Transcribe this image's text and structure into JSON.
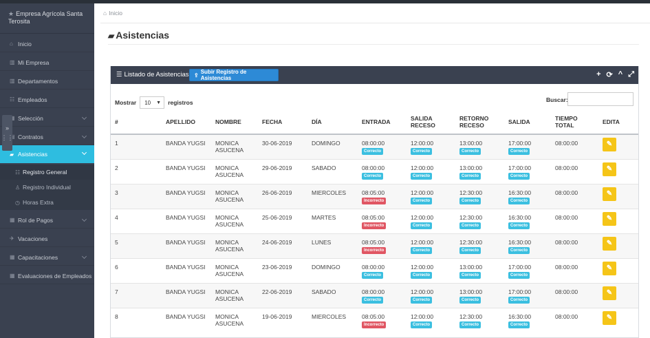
{
  "app": {
    "brand": "Empresa Agrícola Santa Terosita"
  },
  "sidebar": {
    "items": [
      {
        "label": "Inicio",
        "icon": "home-icon"
      },
      {
        "label": "Mi Empresa",
        "icon": "building-icon"
      },
      {
        "label": "Departamentos",
        "icon": "building-icon"
      },
      {
        "label": "Empleados",
        "icon": "users-icon"
      },
      {
        "label": "Selección",
        "icon": "grid-icon"
      },
      {
        "label": "Contratos",
        "icon": "file-icon"
      },
      {
        "label": "Asistencias",
        "icon": "book-icon"
      },
      {
        "label": "Rol de Pagos",
        "icon": "grid-icon"
      },
      {
        "label": "Vacaciones",
        "icon": "plane-icon"
      },
      {
        "label": "Capacitaciones",
        "icon": "grid-icon"
      },
      {
        "label": "Evaluaciones de Empleados",
        "icon": "grid-icon"
      }
    ],
    "subitems": [
      {
        "label": "Registro General",
        "icon": "users-icon"
      },
      {
        "label": "Registro Individual",
        "icon": "user-icon"
      },
      {
        "label": "Horas Extra",
        "icon": "clock-icon"
      }
    ]
  },
  "breadcrumb": {
    "home": "Inicio"
  },
  "page": {
    "title": "Asistencias"
  },
  "panel": {
    "title": "Listado de Asistencias",
    "upload_label": "Subir Registro de Asistencias",
    "tools": [
      "+",
      "⟳",
      "^",
      "⤢"
    ]
  },
  "controls": {
    "show_label": "Mostrar",
    "page_size": "10",
    "records_label": "registros",
    "search_label": "Buscar:",
    "search_value": ""
  },
  "table": {
    "headers": [
      "#",
      "APELLIDO",
      "NOMBRE",
      "FECHA",
      "DÍA",
      "ENTRADA",
      "SALIDA RECESO",
      "RETORNO RECESO",
      "SALIDA",
      "TIEMPO TOTAL",
      "EDITA"
    ],
    "rows": [
      {
        "n": "1",
        "apellido": "BANDA YUGSI",
        "nombre": "MONICA ASUCENA",
        "fecha": "30-06-2019",
        "dia": "DOMINGO",
        "entrada": "08:00:00",
        "entrada_s": "Correcto",
        "sal_rec": "12:00:00",
        "sal_rec_s": "Correcto",
        "ret_rec": "13:00:00",
        "ret_rec_s": "Correcto",
        "salida": "17:00:00",
        "salida_s": "Correcto",
        "total": "08:00:00"
      },
      {
        "n": "2",
        "apellido": "BANDA YUGSI",
        "nombre": "MONICA ASUCENA",
        "fecha": "29-06-2019",
        "dia": "SABADO",
        "entrada": "08:00:00",
        "entrada_s": "Correcto",
        "sal_rec": "12:00:00",
        "sal_rec_s": "Correcto",
        "ret_rec": "13:00:00",
        "ret_rec_s": "Correcto",
        "salida": "17:00:00",
        "salida_s": "Correcto",
        "total": "08:00:00"
      },
      {
        "n": "3",
        "apellido": "BANDA YUGSI",
        "nombre": "MONICA ASUCENA",
        "fecha": "26-06-2019",
        "dia": "MIERCOLES",
        "entrada": "08:05:00",
        "entrada_s": "Incorrecto",
        "sal_rec": "12:00:00",
        "sal_rec_s": "Correcto",
        "ret_rec": "12:30:00",
        "ret_rec_s": "Correcto",
        "salida": "16:30:00",
        "salida_s": "Correcto",
        "total": "08:00:00"
      },
      {
        "n": "4",
        "apellido": "BANDA YUGSI",
        "nombre": "MONICA ASUCENA",
        "fecha": "25-06-2019",
        "dia": "MARTES",
        "entrada": "08:05:00",
        "entrada_s": "Incorrecto",
        "sal_rec": "12:00:00",
        "sal_rec_s": "Correcto",
        "ret_rec": "12:30:00",
        "ret_rec_s": "Correcto",
        "salida": "16:30:00",
        "salida_s": "Correcto",
        "total": "08:00:00"
      },
      {
        "n": "5",
        "apellido": "BANDA YUGSI",
        "nombre": "MONICA ASUCENA",
        "fecha": "24-06-2019",
        "dia": "LUNES",
        "entrada": "08:05:00",
        "entrada_s": "Incorrecto",
        "sal_rec": "12:00:00",
        "sal_rec_s": "Correcto",
        "ret_rec": "12:30:00",
        "ret_rec_s": "Correcto",
        "salida": "16:30:00",
        "salida_s": "Correcto",
        "total": "08:00:00"
      },
      {
        "n": "6",
        "apellido": "BANDA YUGSI",
        "nombre": "MONICA ASUCENA",
        "fecha": "23-06-2019",
        "dia": "DOMINGO",
        "entrada": "08:00:00",
        "entrada_s": "Correcto",
        "sal_rec": "12:00:00",
        "sal_rec_s": "Correcto",
        "ret_rec": "13:00:00",
        "ret_rec_s": "Correcto",
        "salida": "17:00:00",
        "salida_s": "Correcto",
        "total": "08:00:00"
      },
      {
        "n": "7",
        "apellido": "BANDA YUGSI",
        "nombre": "MONICA ASUCENA",
        "fecha": "22-06-2019",
        "dia": "SABADO",
        "entrada": "08:00:00",
        "entrada_s": "Correcto",
        "sal_rec": "12:00:00",
        "sal_rec_s": "Correcto",
        "ret_rec": "13:00:00",
        "ret_rec_s": "Correcto",
        "salida": "17:00:00",
        "salida_s": "Correcto",
        "total": "08:00:00"
      },
      {
        "n": "8",
        "apellido": "BANDA YUGSI",
        "nombre": "MONICA ASUCENA",
        "fecha": "19-06-2019",
        "dia": "MIERCOLES",
        "entrada": "08:05:00",
        "entrada_s": "Incorrecto",
        "sal_rec": "12:00:00",
        "sal_rec_s": "Correcto",
        "ret_rec": "12:30:00",
        "ret_rec_s": "Correcto",
        "salida": "16:30:00",
        "salida_s": "Correcto",
        "total": "08:00:00"
      }
    ]
  },
  "colors": {
    "accent": "#2ebde0",
    "sidebar": "#3a4150",
    "ok": "#3bbfe0",
    "bad": "#e05663",
    "edit": "#f5c518",
    "upload": "#2d8ad6"
  }
}
